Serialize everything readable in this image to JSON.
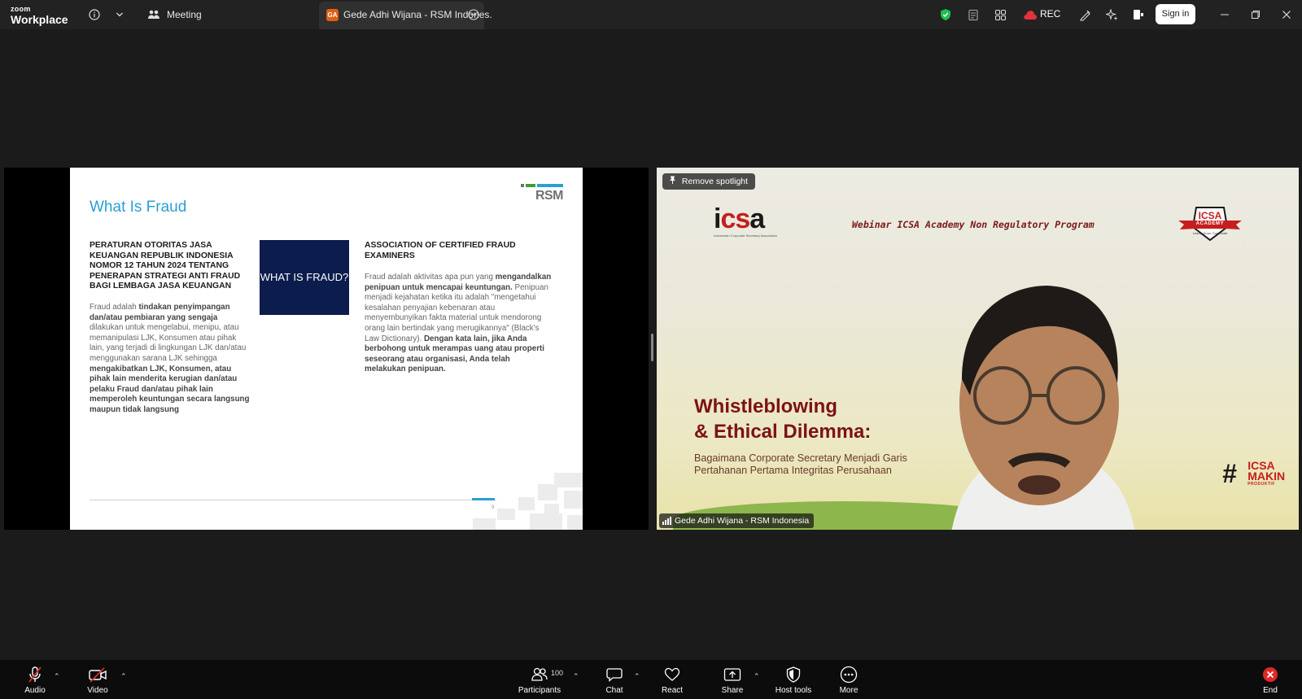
{
  "app": {
    "logo_line1": "zoom",
    "logo_line2": "Workplace"
  },
  "titlebar": {
    "meeting_tab": "Meeting",
    "active_tab": "Gede Adhi Wijana - RSM Indones.",
    "active_tab_badge": "GA",
    "rec_label": "REC",
    "signin_label": "Sign in"
  },
  "slide": {
    "title": "What Is Fraud",
    "logo_text": "RSM",
    "left_heading": "PERATURAN OTORITAS JASA KEUANGAN REPUBLIK INDONESIA NOMOR 12 TAHUN 2024 TENTANG PENERAPAN STRATEGI ANTI FRAUD BAGI LEMBAGA JASA KEUANGAN",
    "left_body": {
      "p1": "Fraud adalah ",
      "b1": "tindakan penyimpangan dan/atau pembiaran yang sengaja",
      "p2": " dilakukan untuk mengelabui, menipu, atau memanipulasi LJK, Konsumen atau pihak lain, yang terjadi di lingkungan LJK dan/atau menggunakan sarana LJK sehingga ",
      "b2": "mengakibatkan LJK, Konsumen, atau pihak lain menderita kerugian dan/atau pelaku Fraud dan/atau pihak lain memperoleh keuntungan secara langsung maupun tidak langsung"
    },
    "center_box": "WHAT IS FRAUD?",
    "right_heading": "ASSOCIATION OF CERTIFIED FRAUD EXAMINERS",
    "right_body": {
      "p1": "Fraud adalah aktivitas apa pun yang ",
      "b1": "mengandalkan penipuan untuk mencapai keuntungan.",
      "p2": " Penipuan menjadi kejahatan ketika itu adalah \"mengetahui kesalahan penyajian kebenaran atau menyembunyikan fakta material untuk mendorong orang lain bertindak yang merugikannya\" (Black's Law Dictionary). ",
      "b2": "Dengan kata lain, jika Anda berbohong untuk merampas uang atau properti seseorang atau organisasi, Anda telah melakukan penipuan."
    },
    "page_number": "9"
  },
  "camera": {
    "spotlight_label": "Remove spotlight",
    "icsa_logo": "icsa",
    "icsa_logo_sub": "Indonesian Corporate Secretary Association",
    "webinar_text": "Webinar ICSA Academy Non Regulatory Program",
    "academy_badge": "ICSA",
    "academy_ribbon": "ACADEMY",
    "academy_tagline": "Learn. Grow. Contribute",
    "headline_line1": "Whistleblowing",
    "headline_line2": "& Ethical Dilemma:",
    "subhead_line1": "Bagaimana Corporate Secretary Menjadi Garis",
    "subhead_line2": "Pertahanan Pertama Integritas Perusahaan",
    "hashtag_main": "#",
    "hashtag_line1": "ICSA",
    "hashtag_line2": "MAKIN",
    "hashtag_line3": "PRODUKTIF",
    "participant_name": "Gede Adhi Wijana - RSM Indonesia"
  },
  "toolbar": {
    "audio": "Audio",
    "video": "Video",
    "participants": "Participants",
    "participants_count": "100",
    "chat": "Chat",
    "react": "React",
    "share": "Share",
    "host_tools": "Host tools",
    "more": "More",
    "end": "End"
  },
  "colors": {
    "accent_blue": "#2aa0d4",
    "navy": "#0b1c4d",
    "end_red": "#e02828",
    "rec_red": "#e0333a",
    "shield_green": "#1fbf4f"
  }
}
